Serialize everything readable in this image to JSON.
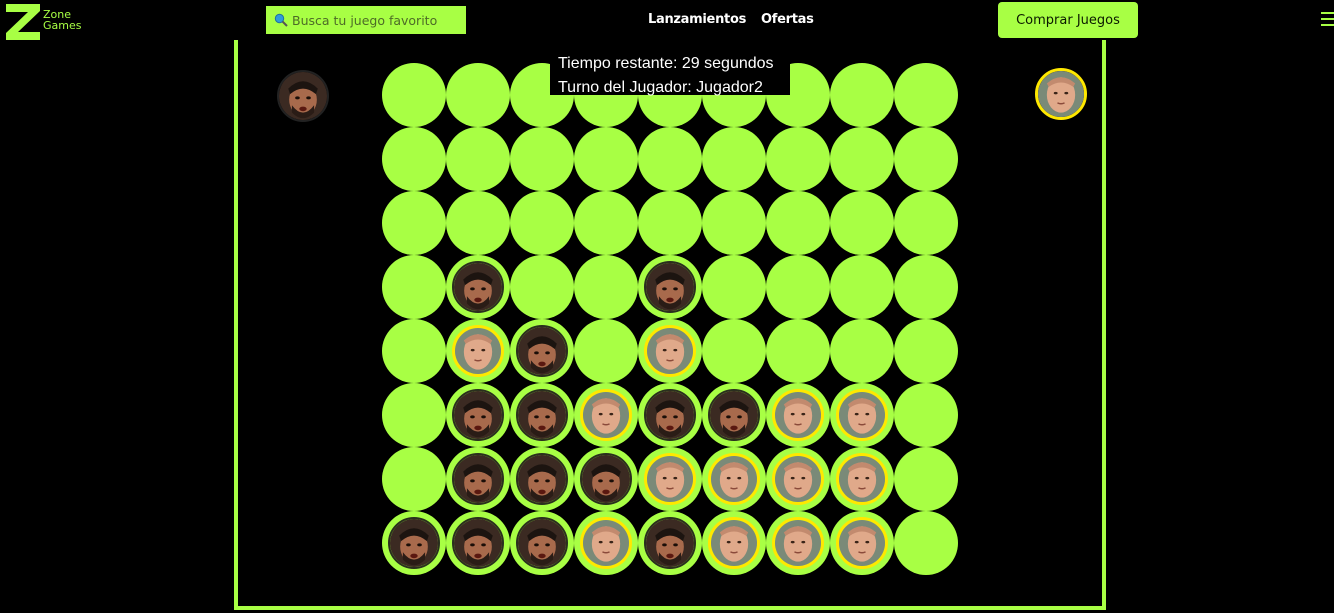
{
  "header": {
    "logo_line1": "Zone",
    "logo_line2": "Games",
    "search_placeholder": "Busca tu juego favorito",
    "nav": [
      "Lanzamientos",
      "Ofertas"
    ],
    "buy_label": "Comprar Juegos"
  },
  "game": {
    "time_text": "Tiempo restante: 29 segundos",
    "turn_text": "Turno del Jugador: Jugador2",
    "players": [
      {
        "id": "p1",
        "ring": "#2a2f1e"
      },
      {
        "id": "p2",
        "ring": "#ffe800"
      }
    ],
    "board": [
      [
        0,
        0,
        0,
        0,
        0,
        0,
        0,
        0,
        0
      ],
      [
        0,
        0,
        0,
        0,
        0,
        0,
        0,
        0,
        0
      ],
      [
        0,
        0,
        0,
        0,
        0,
        0,
        0,
        0,
        0
      ],
      [
        0,
        1,
        0,
        0,
        1,
        0,
        0,
        0,
        0
      ],
      [
        0,
        2,
        1,
        0,
        2,
        0,
        0,
        0,
        0
      ],
      [
        0,
        1,
        1,
        2,
        1,
        1,
        2,
        2,
        0
      ],
      [
        0,
        1,
        1,
        1,
        2,
        2,
        2,
        2,
        0
      ],
      [
        1,
        1,
        1,
        2,
        1,
        2,
        2,
        2,
        0
      ]
    ]
  },
  "colors": {
    "accent": "#a8ff44",
    "background": "#000000",
    "player2_ring": "#ffe800"
  }
}
